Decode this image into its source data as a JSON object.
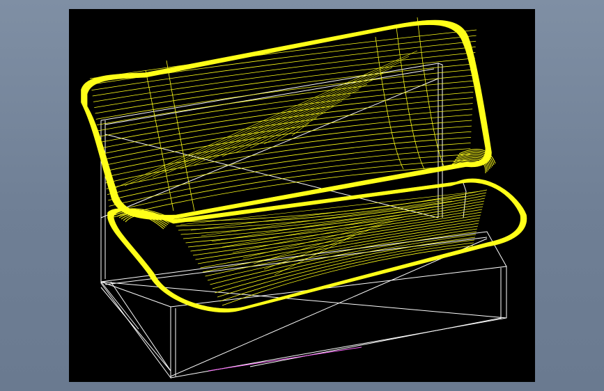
{
  "canvas": {
    "background_color": "#000000",
    "surround_color": "#7686a0"
  },
  "model": {
    "object_type": "sofa-wireframe",
    "wire_colors": {
      "body": "#ffff1a",
      "base": "#ffffff",
      "edge_accent": "#ff66ff"
    }
  }
}
